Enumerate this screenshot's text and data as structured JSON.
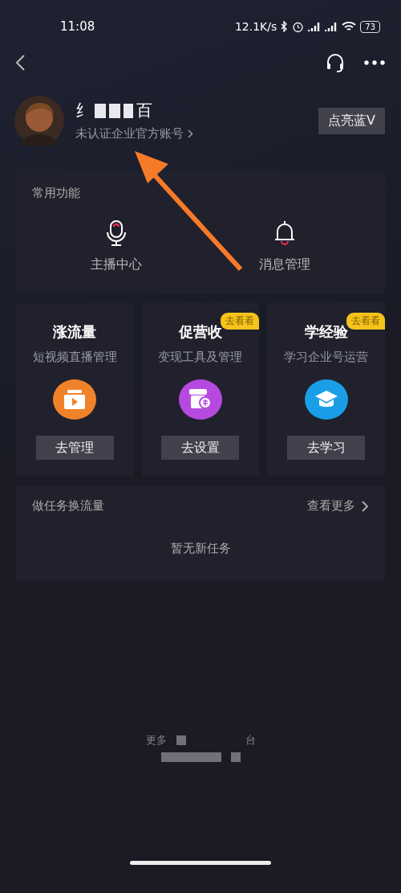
{
  "status_bar": {
    "time": "11:08",
    "net_speed": "12.1K/s",
    "battery": "73"
  },
  "profile": {
    "name_start": "纟",
    "name_end": "百",
    "subtitle": "未认证企业官方账号",
    "verify_button": "点亮蓝V"
  },
  "common_functions": {
    "title": "常用功能",
    "items": [
      {
        "kind": "mic",
        "label": "主播中心"
      },
      {
        "kind": "bell",
        "label": "消息管理"
      }
    ]
  },
  "feature_cards": [
    {
      "kind": "video",
      "title": "涨流量",
      "subtitle": "短视频直播管理",
      "button": "去管理",
      "color": "#f0822a"
    },
    {
      "kind": "shop",
      "title": "促营收",
      "subtitle": "变现工具及管理",
      "button": "去设置",
      "badge": "去看看",
      "color": "#b64ae0"
    },
    {
      "kind": "cap",
      "title": "学经验",
      "subtitle": "学习企业号运营",
      "button": "去学习",
      "badge": "去看看",
      "color": "#1a9ee8"
    }
  ],
  "tasks": {
    "title": "做任务换流量",
    "more": "查看更多",
    "empty": "暂无新任务"
  },
  "footer": {
    "text_start": "更多",
    "text_end": "台"
  }
}
